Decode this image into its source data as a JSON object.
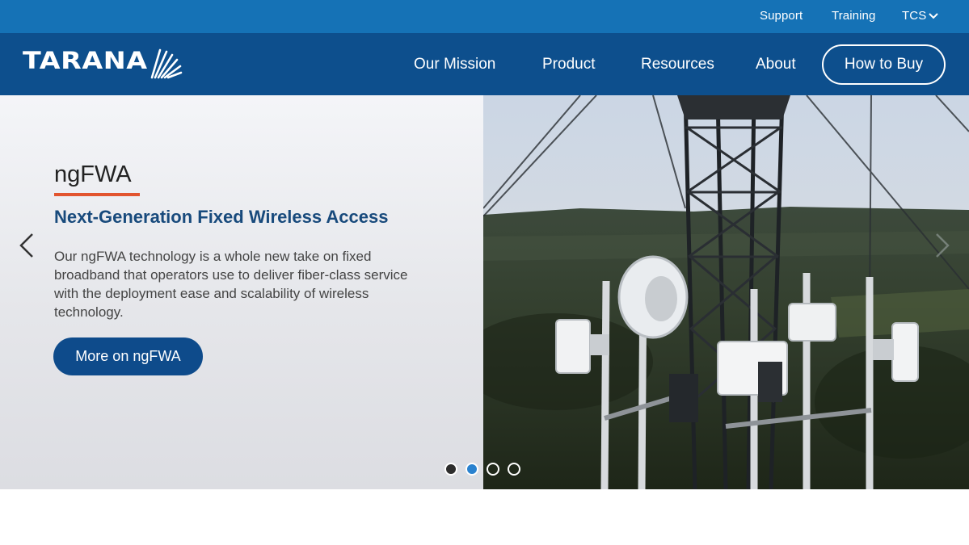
{
  "utility": {
    "support": "Support",
    "training": "Training",
    "region": "TCS"
  },
  "brand": {
    "name": "TARANA"
  },
  "nav": {
    "items": [
      "Our Mission",
      "Product",
      "Resources",
      "About"
    ],
    "cta": "How to Buy"
  },
  "slide": {
    "eyebrow": "ngFWA",
    "title": "Next-Generation Fixed Wireless Access",
    "body": "Our ngFWA technology is a whole new take on fixed broadband that operators use to deliver fiber-class service with the deployment ease and scalability of wireless technology.",
    "cta": "More on ngFWA",
    "active_index": 2,
    "total": 4
  },
  "colors": {
    "utility_bar": "#1572b6",
    "nav_bar": "#0d4f8d",
    "accent_underline": "#e2542f",
    "title_blue": "#184a7c",
    "active_dot": "#2a82cf"
  },
  "icons": {
    "prev": "chevron-left-icon",
    "next": "chevron-right-icon",
    "region_caret": "chevron-down-icon",
    "logo_mark": "sunburst-logo-icon"
  }
}
